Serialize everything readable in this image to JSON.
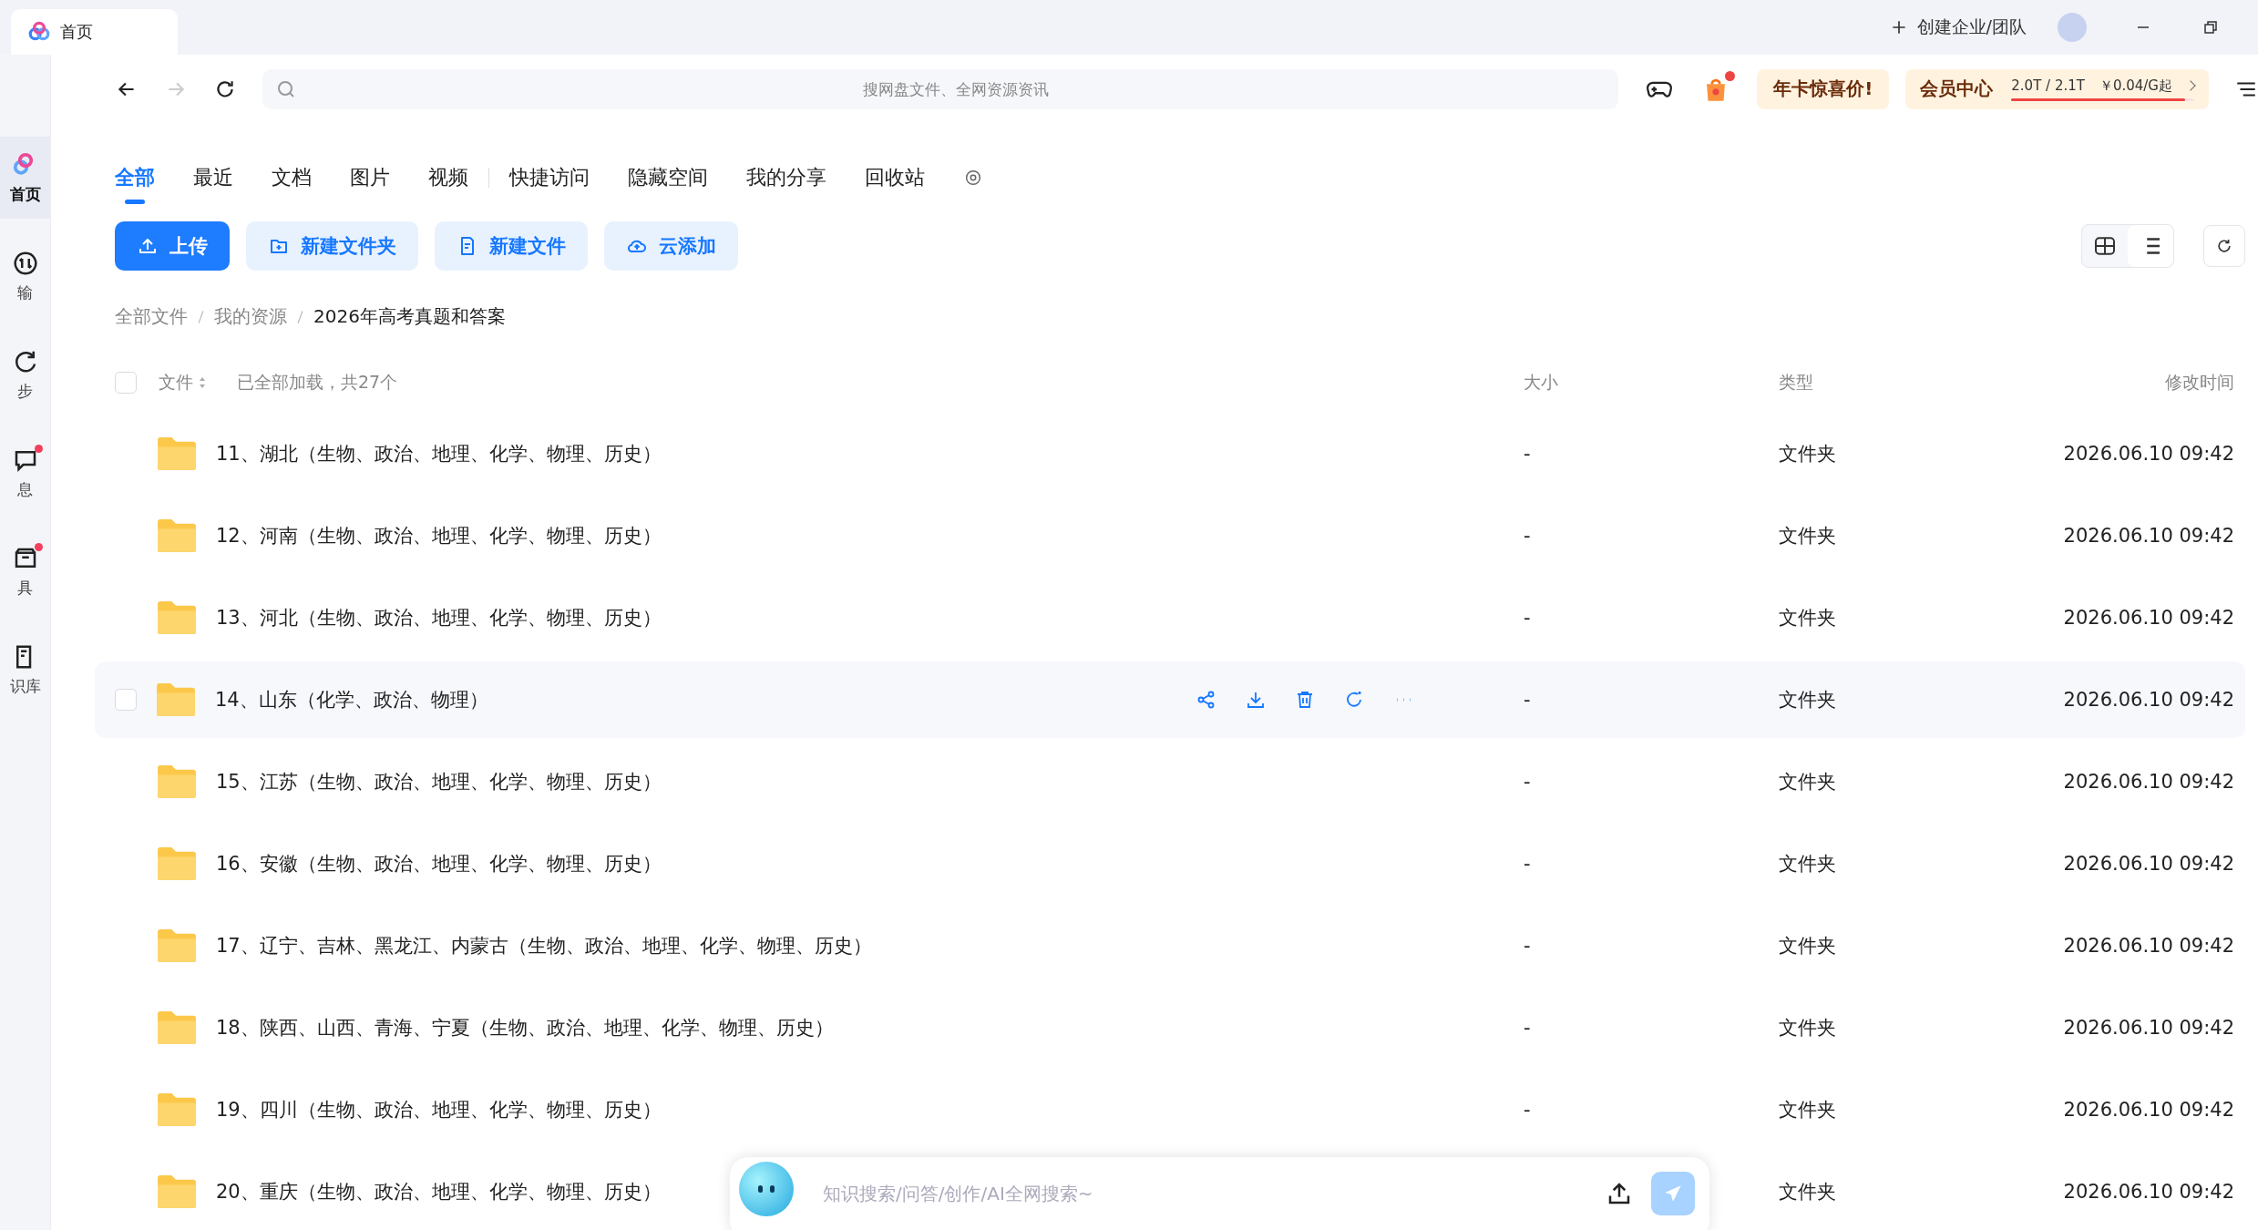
{
  "window": {
    "tab_title": "首页",
    "create_team": "创建企业/团队"
  },
  "sidebar": {
    "items": [
      {
        "label": "首页",
        "selected": true,
        "badge": false
      },
      {
        "label": "输",
        "selected": false,
        "badge": false
      },
      {
        "label": "步",
        "selected": false,
        "badge": false
      },
      {
        "label": "息",
        "selected": false,
        "badge": true
      },
      {
        "label": "具",
        "selected": false,
        "badge": true
      },
      {
        "label": "识库",
        "selected": false,
        "badge": false
      }
    ]
  },
  "toolbar": {
    "search_placeholder": "搜网盘文件、全网资源资讯",
    "promo": "年卡惊喜价!",
    "vip": {
      "label": "会员中心",
      "storage": "2.0T / 2.1T",
      "level": 0.95,
      "price": "￥0.04/G起"
    }
  },
  "tabs": [
    {
      "label": "全部",
      "selected": true
    },
    {
      "label": "最近",
      "selected": false
    },
    {
      "label": "文档",
      "selected": false
    },
    {
      "label": "图片",
      "selected": false
    },
    {
      "label": "视频",
      "selected": false
    },
    {
      "label": "快捷访问",
      "selected": false
    },
    {
      "label": "隐藏空间",
      "selected": false
    },
    {
      "label": "我的分享",
      "selected": false
    },
    {
      "label": "回收站",
      "selected": false
    }
  ],
  "actions": [
    {
      "label": "上传",
      "kind": "primary"
    },
    {
      "label": "新建文件夹",
      "kind": "folder"
    },
    {
      "label": "新建文件",
      "kind": "file"
    },
    {
      "label": "云添加",
      "kind": "cloud"
    }
  ],
  "breadcrumb": [
    "全部文件",
    "我的资源",
    "2026年高考真题和答案"
  ],
  "table": {
    "columns": [
      "文件",
      "大小",
      "类型",
      "修改时间"
    ],
    "status": "已全部加载，共27个",
    "header_checked": false,
    "rows": [
      {
        "name": "11、湖北（生物、政治、地理、化学、物理、历史）",
        "size": "-",
        "type": "文件夹",
        "modified": "2026.06.10 09:42",
        "hovered": false
      },
      {
        "name": "12、河南（生物、政治、地理、化学、物理、历史）",
        "size": "-",
        "type": "文件夹",
        "modified": "2026.06.10 09:42",
        "hovered": false
      },
      {
        "name": "13、河北（生物、政治、地理、化学、物理、历史）",
        "size": "-",
        "type": "文件夹",
        "modified": "2026.06.10 09:42",
        "hovered": false
      },
      {
        "name": "14、山东（化学、政治、物理）",
        "size": "-",
        "type": "文件夹",
        "modified": "2026.06.10 09:42",
        "hovered": true,
        "checked": false
      },
      {
        "name": "15、江苏（生物、政治、地理、化学、物理、历史）",
        "size": "-",
        "type": "文件夹",
        "modified": "2026.06.10 09:42",
        "hovered": false
      },
      {
        "name": "16、安徽（生物、政治、地理、化学、物理、历史）",
        "size": "-",
        "type": "文件夹",
        "modified": "2026.06.10 09:42",
        "hovered": false
      },
      {
        "name": "17、辽宁、吉林、黑龙江、内蒙古（生物、政治、地理、化学、物理、历史）",
        "size": "-",
        "type": "文件夹",
        "modified": "2026.06.10 09:42",
        "hovered": false
      },
      {
        "name": "18、陕西、山西、青海、宁夏（生物、政治、地理、化学、物理、历史）",
        "size": "-",
        "type": "文件夹",
        "modified": "2026.06.10 09:42",
        "hovered": false
      },
      {
        "name": "19、四川（生物、政治、地理、化学、物理、历史）",
        "size": "-",
        "type": "文件夹",
        "modified": "2026.06.10 09:42",
        "hovered": false
      },
      {
        "name": "20、重庆（生物、政治、地理、化学、物理、历史）",
        "type": "文件夹",
        "modified": "2026.06.10 09:42",
        "hovered": false
      }
    ]
  },
  "ai_bar": {
    "placeholder": "知识搜索/问答/创作/AI全网搜索~"
  }
}
